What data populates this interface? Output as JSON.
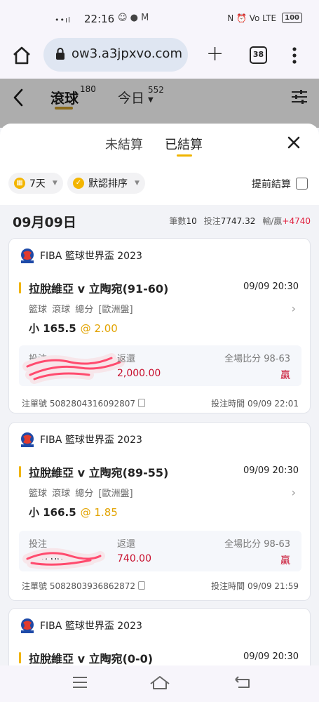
{
  "status_bar": {
    "time": "22:16",
    "signal_dots": "••ıl",
    "notif_icons": "☺ ● M",
    "right_icons": "N ⏰ Vo LTE",
    "battery": "100"
  },
  "browser": {
    "url": "ow3.a3jpxvo.com",
    "tab_count": "38"
  },
  "header": {
    "live_tab": "滾球",
    "live_count": "180",
    "today_tab": "今日",
    "today_count": "552"
  },
  "sheet": {
    "unsettled_label": "未結算",
    "settled_label": "已結算"
  },
  "filters": {
    "days_label": "7天",
    "sort_label": "默認排序",
    "early_settle_label": "提前結算"
  },
  "date_group": {
    "date": "09月09日",
    "count_label": "筆數",
    "count": "10",
    "stake_label": "投注",
    "stake": "7747.32",
    "winloss_label": "輸/贏",
    "winloss": "+4740"
  },
  "labels": {
    "stake": "投注",
    "return": "返還",
    "full_score": "全場比分",
    "order_no": "注單號",
    "bet_time": "投注時間"
  },
  "bets": [
    {
      "league": "FIBA 籃球世界盃 2023",
      "match": "拉脫維亞 v 立陶宛(91-60)",
      "match_time": "09/09 20:30",
      "market": "籃球 滾球  總分 [歐洲盤]",
      "pick": "小 165.5",
      "odds": "@ 2.00",
      "stake": "1,000.00",
      "return": "2,000.00",
      "score": "98-63",
      "result": "贏",
      "order_no": "5082804316092807",
      "bet_time": "09/09 22:01"
    },
    {
      "league": "FIBA 籃球世界盃 2023",
      "match": "拉脫維亞 v 立陶宛(89-55)",
      "match_time": "09/09 20:30",
      "market": "籃球 滾球  總分 [歐洲盤]",
      "pick": "小 166.5",
      "odds": "@ 1.85",
      "stake": "400.00",
      "return": "740.00",
      "score": "98-63",
      "result": "贏",
      "order_no": "5082803936862872",
      "bet_time": "09/09 21:59"
    },
    {
      "league": "FIBA 籃球世界盃 2023",
      "match": "拉脫維亞 v 立陶宛(0-0)",
      "match_time": "09/09 20:30"
    }
  ],
  "colors": {
    "accent_gold": "#f0b400",
    "win_red": "#c8102e"
  }
}
